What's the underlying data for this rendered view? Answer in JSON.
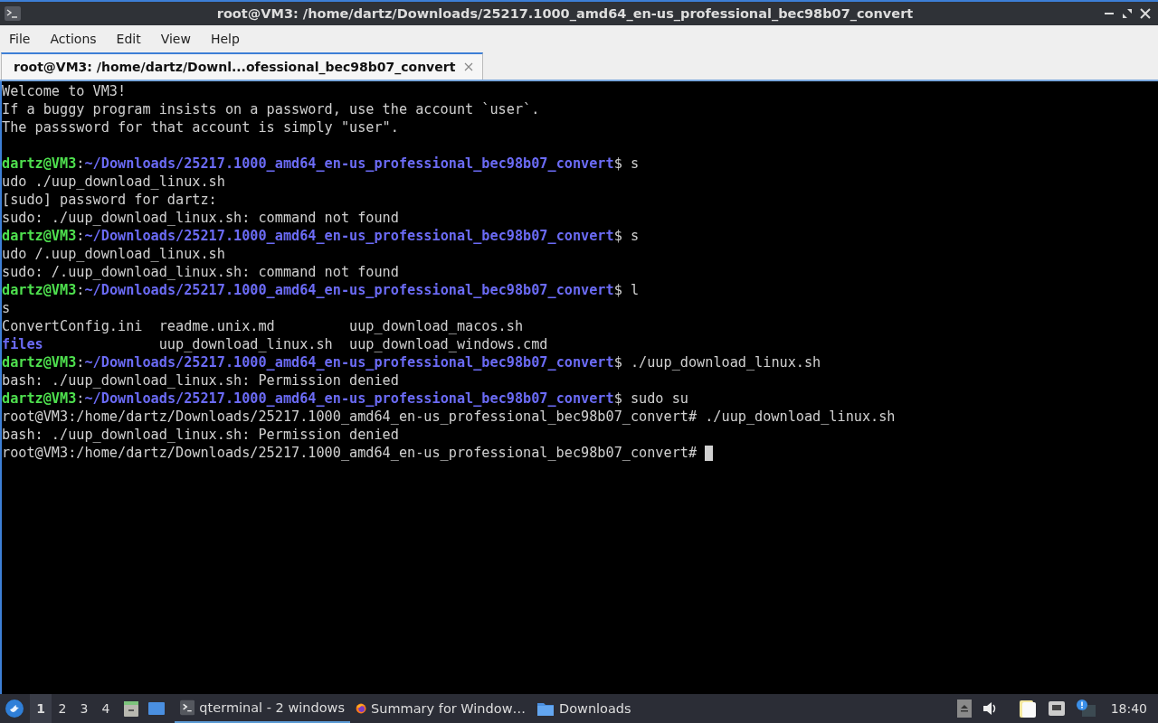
{
  "window": {
    "title": "root@VM3: /home/dartz/Downloads/25217.1000_amd64_en-us_professional_bec98b07_convert"
  },
  "menu": [
    "File",
    "Actions",
    "Edit",
    "View",
    "Help"
  ],
  "tabs": [
    {
      "label": "root@VM3: /home/dartz/Downl...ofessional_bec98b07_convert",
      "selected": true
    }
  ],
  "terminal": {
    "lines": [
      {
        "segments": [
          {
            "kind": "text",
            "text": "Welcome to VM3!"
          }
        ]
      },
      {
        "segments": [
          {
            "kind": "text",
            "text": "If a buggy program insists on a password, use the account `user`."
          }
        ]
      },
      {
        "segments": [
          {
            "kind": "text",
            "text": "The passsword for that account is simply \"user\"."
          }
        ]
      },
      {
        "kind": "blank"
      },
      {
        "segments": [
          {
            "kind": "user",
            "text": "dartz@VM3"
          },
          {
            "kind": "text",
            "text": ":"
          },
          {
            "kind": "path",
            "text": "~/Downloads/25217.1000_amd64_en-us_professional_bec98b07_convert"
          },
          {
            "kind": "text",
            "text": "$ s"
          }
        ]
      },
      {
        "segments": [
          {
            "kind": "text",
            "text": "udo ./uup_download_linux.sh"
          }
        ]
      },
      {
        "segments": [
          {
            "kind": "text",
            "text": "[sudo] password for dartz:"
          }
        ]
      },
      {
        "segments": [
          {
            "kind": "text",
            "text": "sudo: ./uup_download_linux.sh: command not found"
          }
        ]
      },
      {
        "segments": [
          {
            "kind": "user",
            "text": "dartz@VM3"
          },
          {
            "kind": "text",
            "text": ":"
          },
          {
            "kind": "path",
            "text": "~/Downloads/25217.1000_amd64_en-us_professional_bec98b07_convert"
          },
          {
            "kind": "text",
            "text": "$ s"
          }
        ]
      },
      {
        "segments": [
          {
            "kind": "text",
            "text": "udo /.uup_download_linux.sh"
          }
        ]
      },
      {
        "segments": [
          {
            "kind": "text",
            "text": "sudo: /.uup_download_linux.sh: command not found"
          }
        ]
      },
      {
        "segments": [
          {
            "kind": "user",
            "text": "dartz@VM3"
          },
          {
            "kind": "text",
            "text": ":"
          },
          {
            "kind": "path",
            "text": "~/Downloads/25217.1000_amd64_en-us_professional_bec98b07_convert"
          },
          {
            "kind": "text",
            "text": "$ l"
          }
        ]
      },
      {
        "segments": [
          {
            "kind": "text",
            "text": "s"
          }
        ]
      },
      {
        "segments": [
          {
            "kind": "text",
            "text": "ConvertConfig.ini  readme.unix.md         uup_download_macos.sh"
          }
        ]
      },
      {
        "segments": [
          {
            "kind": "path",
            "text": "files"
          },
          {
            "kind": "text",
            "text": "              uup_download_linux.sh  uup_download_windows.cmd"
          }
        ]
      },
      {
        "segments": [
          {
            "kind": "user",
            "text": "dartz@VM3"
          },
          {
            "kind": "text",
            "text": ":"
          },
          {
            "kind": "path",
            "text": "~/Downloads/25217.1000_amd64_en-us_professional_bec98b07_convert"
          },
          {
            "kind": "text",
            "text": "$ ./uup_download_linux.sh"
          }
        ]
      },
      {
        "segments": [
          {
            "kind": "text",
            "text": "bash: ./uup_download_linux.sh: Permission denied"
          }
        ]
      },
      {
        "segments": [
          {
            "kind": "user",
            "text": "dartz@VM3"
          },
          {
            "kind": "text",
            "text": ":"
          },
          {
            "kind": "path",
            "text": "~/Downloads/25217.1000_amd64_en-us_professional_bec98b07_convert"
          },
          {
            "kind": "text",
            "text": "$ sudo su"
          }
        ]
      },
      {
        "segments": [
          {
            "kind": "text",
            "text": "root@VM3:/home/dartz/Downloads/25217.1000_amd64_en-us_professional_bec98b07_convert# ./uup_download_linux.sh"
          }
        ]
      },
      {
        "segments": [
          {
            "kind": "text",
            "text": "bash: ./uup_download_linux.sh: Permission denied"
          }
        ]
      },
      {
        "segments": [
          {
            "kind": "text",
            "text": "root@VM3:/home/dartz/Downloads/25217.1000_amd64_en-us_professional_bec98b07_convert# "
          },
          {
            "kind": "cursor"
          }
        ]
      }
    ]
  },
  "taskbar": {
    "workspaces": [
      {
        "label": "1",
        "selected": true
      },
      {
        "label": "2",
        "selected": false
      },
      {
        "label": "3",
        "selected": false
      },
      {
        "label": "4",
        "selected": false
      }
    ],
    "tasks": [
      {
        "kind": "terminal",
        "label": "qterminal - 2 windows",
        "selected": true
      },
      {
        "kind": "browser",
        "label": "Summary for Window…",
        "selected": false
      },
      {
        "kind": "folder",
        "label": "Downloads",
        "selected": false
      }
    ],
    "clock": "18:40"
  }
}
